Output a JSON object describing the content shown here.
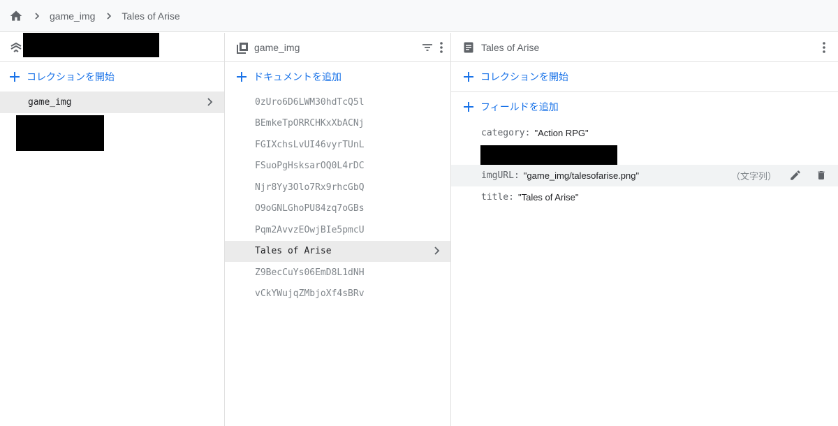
{
  "breadcrumb": {
    "items": [
      "game_img",
      "Tales of Arise"
    ]
  },
  "panel_root": {
    "add_collection": "コレクションを開始",
    "collections": [
      {
        "name": "game_img"
      }
    ]
  },
  "panel_collection": {
    "title": "game_img",
    "add_document": "ドキュメントを追加",
    "documents": [
      "0zUro6D6LWM30hdTcQ5l",
      "BEmkeTpORRCHKxXbACNj",
      "FGIXchsLvUI46vyrTUnL",
      "FSuoPgHsksarOQ0L4rDC",
      "Njr8Yy3Olo7Rx9rhcGbQ",
      "O9oGNLGhoPU84zq7oGBs",
      "Pqm2AvvzEOwjBIe5pmcU",
      "Tales of Arise",
      "Z9BecCuYs06EmD8L1dNH",
      "vCkYWujqZMbjoXf4sBRv"
    ],
    "selected_index": 7
  },
  "panel_document": {
    "title": "Tales of Arise",
    "add_collection": "コレクションを開始",
    "add_field": "フィールドを追加",
    "fields": [
      {
        "key": "category",
        "value": "\"Action RPG\""
      },
      {
        "key": "imgURL",
        "value": "\"game_img/talesofarise.png\"",
        "type": "（文字列）"
      },
      {
        "key": "title",
        "value": "\"Tales of Arise\""
      }
    ]
  },
  "colors": {
    "accent": "#1a73e8",
    "selected_bg": "#ebebeb",
    "icon": "#5f6368"
  }
}
